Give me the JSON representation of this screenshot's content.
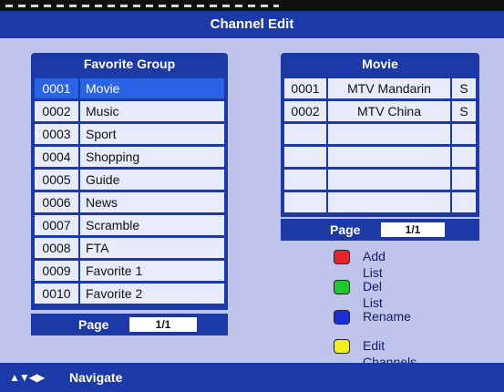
{
  "title": "Channel Edit",
  "favorite_group": {
    "header": "Favorite Group",
    "rows": [
      {
        "num": "0001",
        "name": "Movie",
        "selected": true
      },
      {
        "num": "0002",
        "name": "Music"
      },
      {
        "num": "0003",
        "name": "Sport"
      },
      {
        "num": "0004",
        "name": "Shopping"
      },
      {
        "num": "0005",
        "name": "Guide"
      },
      {
        "num": "0006",
        "name": "News"
      },
      {
        "num": "0007",
        "name": "Scramble"
      },
      {
        "num": "0008",
        "name": "FTA"
      },
      {
        "num": "0009",
        "name": "Favorite 1"
      },
      {
        "num": "0010",
        "name": "Favorite 2"
      }
    ],
    "page_label": "Page",
    "page_value": "1/1"
  },
  "channel_list": {
    "header": "Movie",
    "rows": [
      {
        "num": "0001",
        "name": "MTV Mandarin",
        "flag": "S"
      },
      {
        "num": "0002",
        "name": "MTV China",
        "flag": "S"
      },
      {
        "num": "",
        "name": "",
        "flag": ""
      },
      {
        "num": "",
        "name": "",
        "flag": ""
      },
      {
        "num": "",
        "name": "",
        "flag": ""
      },
      {
        "num": "",
        "name": "",
        "flag": ""
      }
    ],
    "page_label": "Page",
    "page_value": "1/1"
  },
  "legend": [
    {
      "color": "#e8232a",
      "label": "Add List",
      "icon": "red-key-icon"
    },
    {
      "color": "#1fc92b",
      "label": "Del List",
      "icon": "green-key-icon"
    },
    {
      "color": "#1a2fd6",
      "label": "Rename",
      "icon": "blue-key-icon"
    },
    {
      "color": "#f2ee1a",
      "label": "Edit Channels",
      "icon": "yellow-key-icon"
    }
  ],
  "footer": {
    "arrows": "▲▼◀▶",
    "navigate_label": "Navigate"
  }
}
